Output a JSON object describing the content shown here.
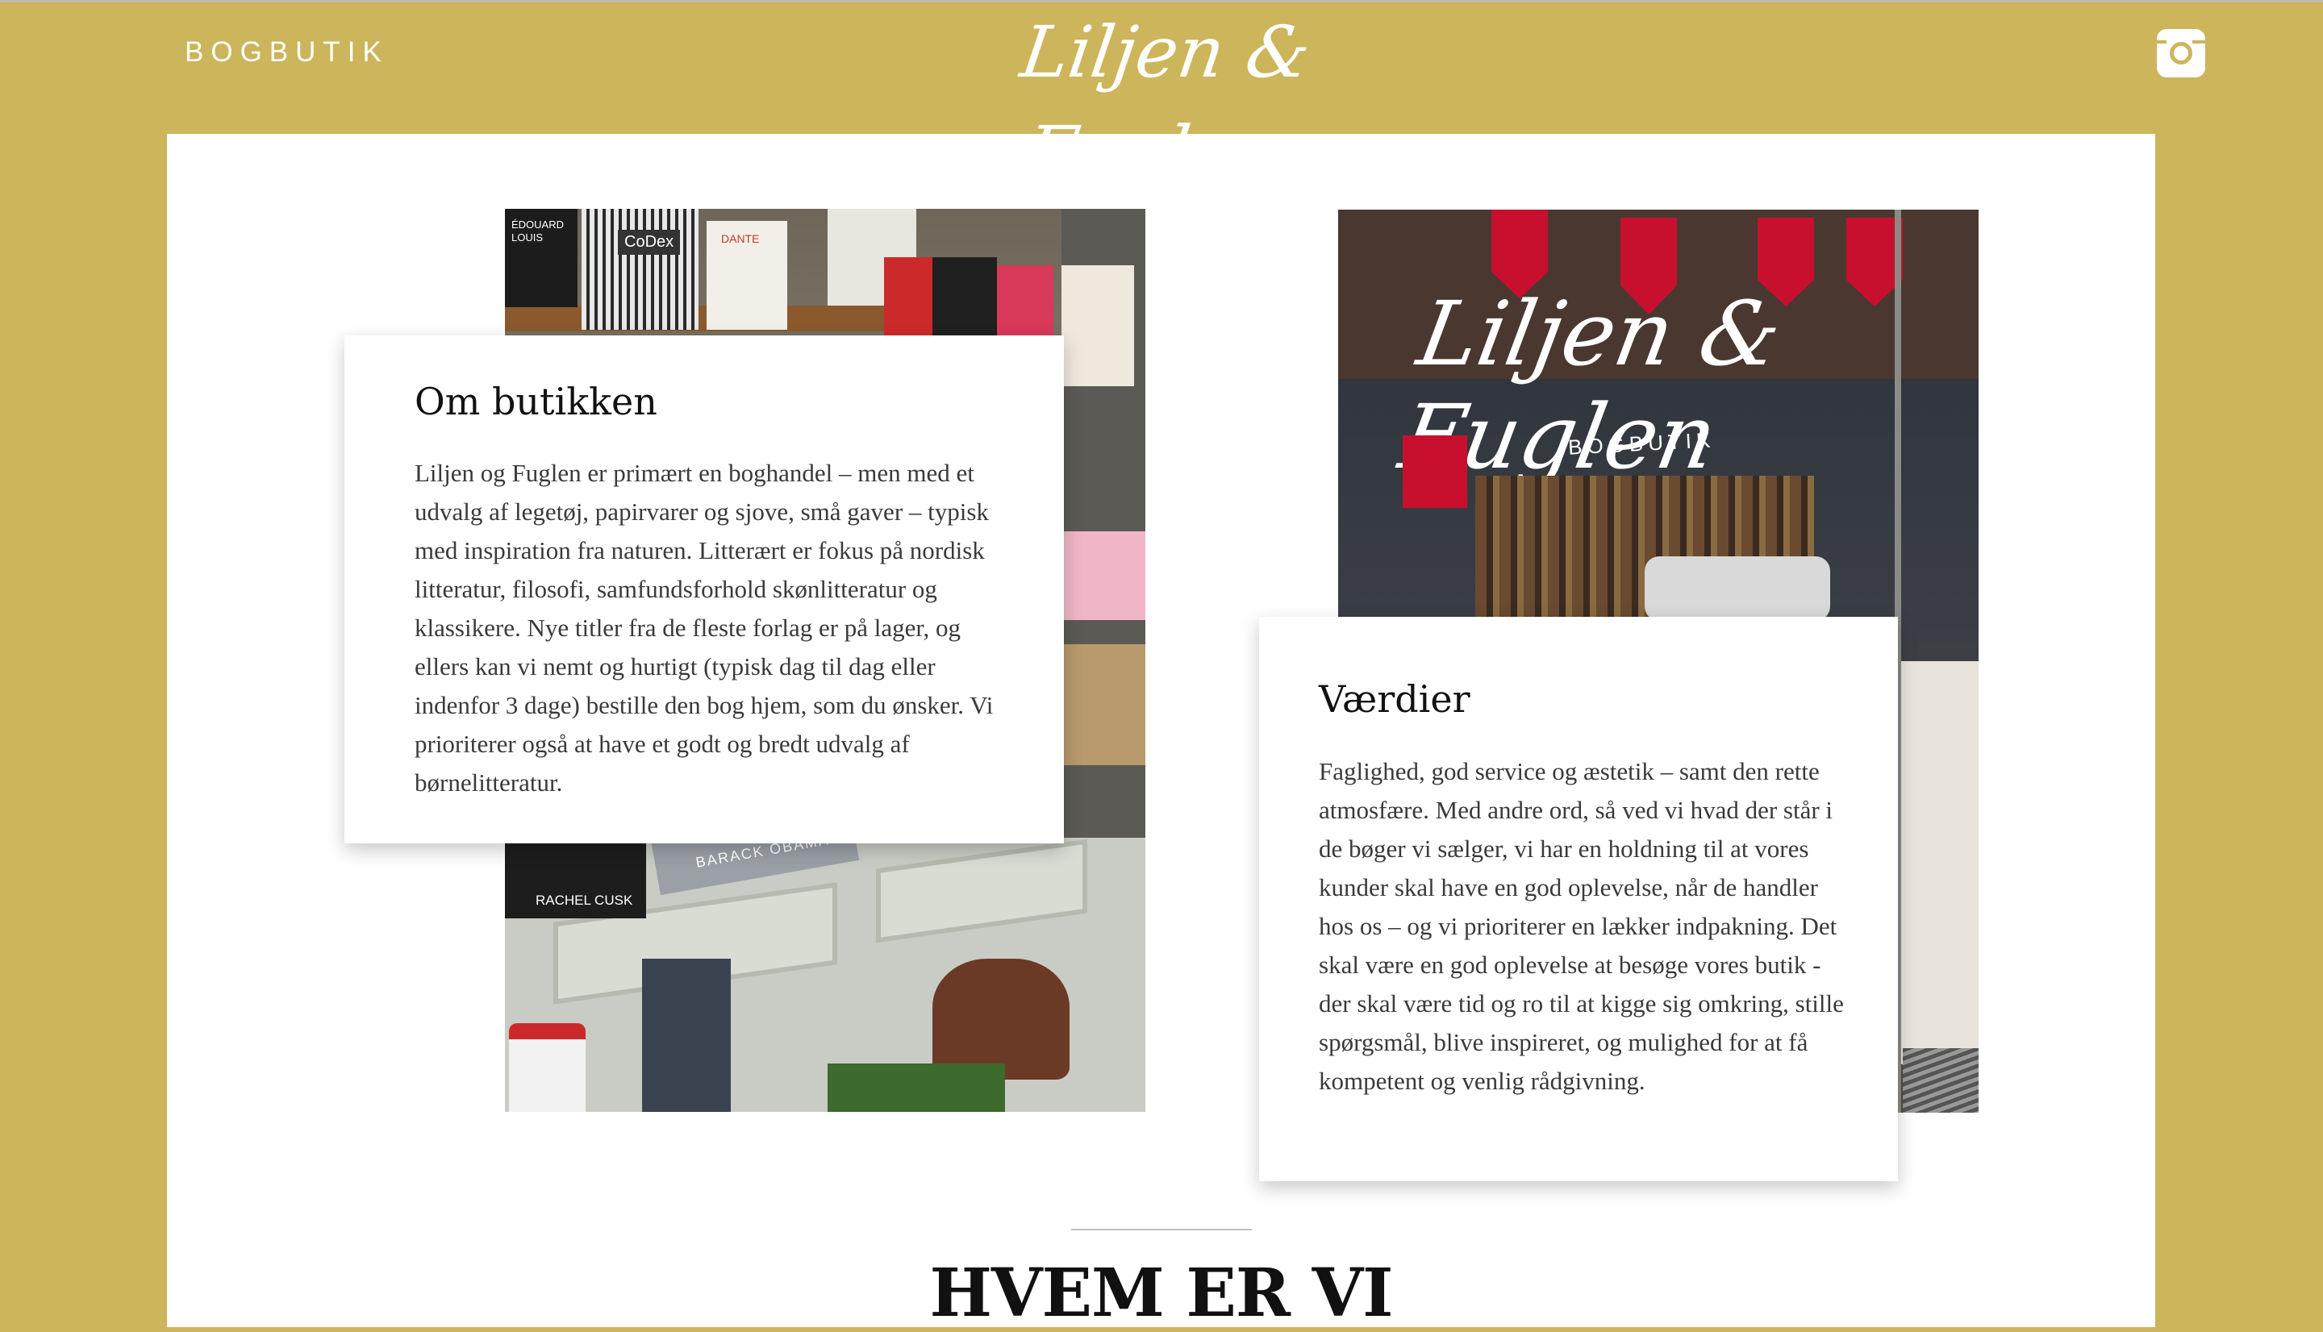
{
  "header": {
    "brand": "BOGBUTIK",
    "logo": "Liljen & Fuglen",
    "instagram_icon": "instagram-icon"
  },
  "left_photo": {
    "books": [
      "ÉDOUARD LOUIS",
      "CoDex",
      "DANTE",
      "RACHEL CUSK",
      "BARACK OBAMA"
    ]
  },
  "right_photo": {
    "window_logo": "Liljen & Fuglen",
    "window_sub": "BOGBUTIK"
  },
  "about": {
    "title": "Om butikken",
    "body": "Liljen og Fuglen er primært en boghandel – men med et udvalg af legetøj, papirvarer og sjove, små gaver – typisk med inspiration fra naturen. Litterært er fokus på nordisk litteratur, filosofi, samfundsforhold skønlitteratur og klassikere. Nye titler fra de fleste forlag er på lager, og ellers kan vi nemt og hurtigt (typisk dag til dag eller indenfor 3 dage) bestille den bog hjem, som du ønsker. Vi prioriterer også at have et godt og bredt udvalg af børnelitteratur."
  },
  "values": {
    "title": "Værdier",
    "body": "Faglighed, god service og æstetik – samt den rette atmosfære. Med andre ord, så ved vi hvad der står i de bøger vi sælger, vi har en holdning til at vores kunder skal have en god oplevelse, når de handler hos os – og vi prioriterer en lækker indpakning. Det skal være en god oplevelse at besøge vores butik - der skal være tid og ro til at kigge sig omkring, stille spørgsmål, blive inspireret, og mulighed for at få kompetent og venlig rådgivning."
  },
  "who": {
    "title": "HVEM ER VI"
  },
  "colors": {
    "background": "#ccb55a",
    "panel": "#ffffff",
    "text": "#3a3a3a"
  }
}
